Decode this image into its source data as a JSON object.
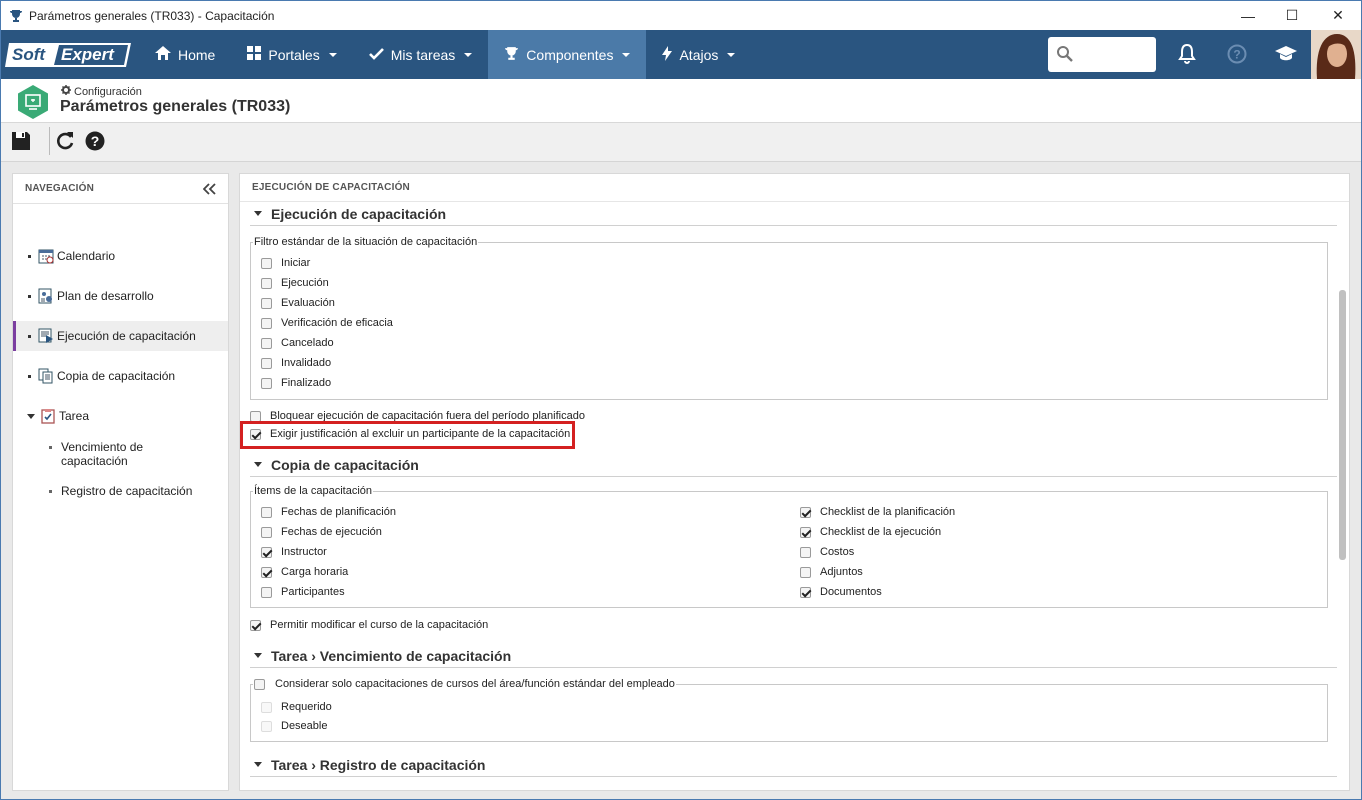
{
  "window": {
    "title": "Parámetros generales (TR033) - Capacitación",
    "minimize": "—",
    "maximize": "☐",
    "close": "✕"
  },
  "logo": {
    "soft": "Soft",
    "expert": "Expert"
  },
  "topnav": {
    "items": [
      {
        "label": "Home"
      },
      {
        "label": "Portales"
      },
      {
        "label": "Mis tareas"
      },
      {
        "label": "Componentes"
      },
      {
        "label": "Atajos"
      }
    ],
    "search_placeholder": ""
  },
  "header": {
    "breadcrumb": "Configuración",
    "title": "Parámetros generales (TR033)"
  },
  "nav": {
    "title": "NAVEGACIÓN",
    "items": [
      {
        "label": "Calendario"
      },
      {
        "label": "Plan de desarrollo"
      },
      {
        "label": "Ejecución de capacitación"
      },
      {
        "label": "Copia de capacitación"
      },
      {
        "label": "Tarea"
      }
    ],
    "subitems": [
      {
        "label": "Vencimiento de capacitación"
      },
      {
        "label": "Registro de capacitación"
      }
    ]
  },
  "main": {
    "title": "EJECUCIÓN DE CAPACITACIÓN",
    "sec1": {
      "title": "Ejecución de capacitación",
      "legend": "Filtro estándar de la situación de capacitación",
      "filters": [
        {
          "label": "Iniciar",
          "checked": false
        },
        {
          "label": "Ejecución",
          "checked": false
        },
        {
          "label": "Evaluación",
          "checked": false
        },
        {
          "label": "Verificación de eficacia",
          "checked": false
        },
        {
          "label": "Cancelado",
          "checked": false
        },
        {
          "label": "Invalidado",
          "checked": false
        },
        {
          "label": "Finalizado",
          "checked": false
        }
      ],
      "block": {
        "label": "Bloquear ejecución de capacitación fuera del período planificado",
        "checked": false
      },
      "require": {
        "label": "Exigir justificación al excluir un participante de la capacitación",
        "checked": true
      }
    },
    "sec2": {
      "title": "Copia de capacitación",
      "legend": "Ítems de la capacitación",
      "left": [
        {
          "label": "Fechas de planificación",
          "checked": false
        },
        {
          "label": "Fechas de ejecución",
          "checked": false
        },
        {
          "label": "Instructor",
          "checked": true
        },
        {
          "label": "Carga horaria",
          "checked": true
        },
        {
          "label": "Participantes",
          "checked": false
        }
      ],
      "right": [
        {
          "label": "Checklist de la planificación",
          "checked": true
        },
        {
          "label": "Checklist de la ejecución",
          "checked": true
        },
        {
          "label": "Costos",
          "checked": false
        },
        {
          "label": "Adjuntos",
          "checked": false
        },
        {
          "label": "Documentos",
          "checked": true
        }
      ],
      "allow": {
        "label": "Permitir modificar el curso de la capacitación",
        "checked": true
      }
    },
    "sec3": {
      "title": "Tarea › Vencimiento de capacitación",
      "legend": "Considerar solo capacitaciones de cursos del área/función estándar del empleado",
      "options": [
        {
          "label": "Requerido"
        },
        {
          "label": "Deseable"
        }
      ]
    },
    "sec4": {
      "title": "Tarea › Registro de capacitación"
    }
  }
}
